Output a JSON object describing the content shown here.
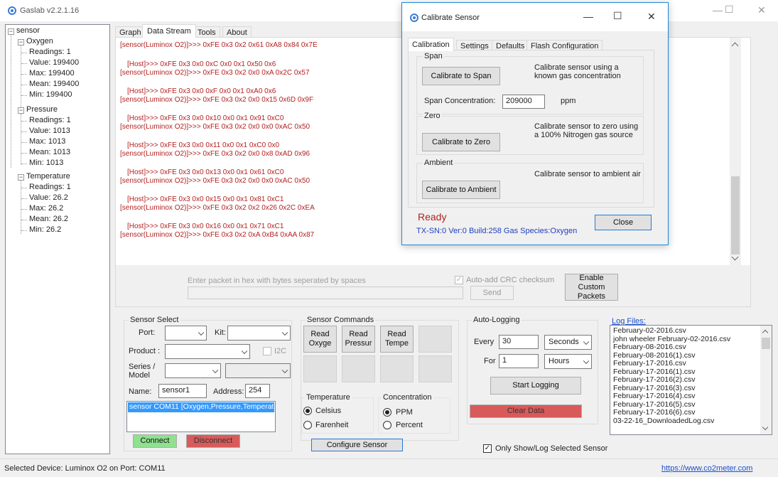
{
  "main_window": {
    "title": "Gaslab v2.2.1.16",
    "controls": {
      "minimize": "—",
      "maximize": "☐",
      "close": "✕"
    }
  },
  "tree": {
    "root": "sensor",
    "groups": [
      {
        "name": "Oxygen",
        "items": [
          "Readings: 1",
          "Value: 199400",
          "Max: 199400",
          "Mean: 199400",
          "Min: 199400"
        ]
      },
      {
        "name": "Pressure",
        "items": [
          "Readings: 1",
          "Value: 1013",
          "Max: 1013",
          "Mean: 1013",
          "Min: 1013"
        ]
      },
      {
        "name": "Temperature",
        "items": [
          "Readings: 1",
          "Value: 26.2",
          "Max: 26.2",
          "Mean: 26.2",
          "Min: 26.2"
        ]
      }
    ]
  },
  "main_tabs": [
    "Graph",
    "Data Stream",
    "Tools",
    "About"
  ],
  "stream": [
    "[sensor(Luminox O2)]>>> 0xFE 0x3 0x2 0x61 0xA8 0x84 0x7E",
    "[Host]>>> 0xFE 0x3 0x0 0xC 0x0 0x1 0x50 0x6",
    "[sensor(Luminox O2)]>>> 0xFE 0x3 0x2 0x0 0xA 0x2C 0x57",
    "[Host]>>> 0xFE 0x3 0x0 0xF 0x0 0x1 0xA0 0x6",
    "[sensor(Luminox O2)]>>> 0xFE 0x3 0x2 0x0 0x15 0x6D 0x9F",
    "[Host]>>> 0xFE 0x3 0x0 0x10 0x0 0x1 0x91 0xC0",
    "[sensor(Luminox O2)]>>> 0xFE 0x3 0x2 0x0 0x0 0xAC 0x50",
    "[Host]>>> 0xFE 0x3 0x0 0x11 0x0 0x1 0xC0 0x0",
    "[sensor(Luminox O2)]>>> 0xFE 0x3 0x2 0x0 0x8 0xAD 0x96",
    "[Host]>>> 0xFE 0x3 0x0 0x13 0x0 0x1 0x61 0xC0",
    "[sensor(Luminox O2)]>>> 0xFE 0x3 0x2 0x0 0x0 0xAC 0x50",
    "[Host]>>> 0xFE 0x3 0x0 0x15 0x0 0x1 0x81 0xC1",
    "[sensor(Luminox O2)]>>> 0xFE 0x3 0x2 0x2 0x26 0x2C 0xEA",
    "[Host]>>> 0xFE 0x3 0x0 0x16 0x0 0x1 0x71 0xC1",
    "[sensor(Luminox O2)]>>> 0xFE 0x3 0x2 0xA 0xB4 0xAA 0x87"
  ],
  "packet": {
    "placeholder": "Enter packet in hex with bytes seperated by spaces",
    "crc_label": "Auto-add CRC checksum",
    "send": "Send",
    "enable_custom": "Enable Custom Packets"
  },
  "sensor_select": {
    "title": "Sensor Select",
    "port_label": "Port:",
    "kit_label": "Kit:",
    "product_label": "Product :",
    "i2c_label": "I2C",
    "series_label": "Series / Model",
    "name_label": "Name:",
    "name_value": "sensor1",
    "address_label": "Address:",
    "address_value": "254",
    "list_item": "sensor COM11 [Oxygen,Pressure,Temperat",
    "connect": "Connect",
    "disconnect": "Disconnect"
  },
  "sensor_commands": {
    "title": "Sensor Commands",
    "buttons": [
      "Read Oxyge",
      "Read Pressur",
      "Read Tempe"
    ],
    "temperature_title": "Temperature",
    "celsius": "Celsius",
    "farenheit": "Farenheit",
    "concentration_title": "Concentration",
    "ppm": "PPM",
    "percent": "Percent",
    "configure": "Configure Sensor"
  },
  "auto_logging": {
    "title": "Auto-Logging",
    "every_label": "Every",
    "every_value": "30",
    "every_unit": "Seconds",
    "for_label": "For",
    "for_value": "1",
    "for_unit": "Hours",
    "start": "Start Logging",
    "clear": "Clear Data",
    "only_show": "Only Show/Log Selected Sensor"
  },
  "log_files": {
    "title": "Log Files:",
    "files": [
      "February-02-2016.csv",
      "john wheeler February-02-2016.csv",
      "February-08-2016.csv",
      "February-08-2016(1).csv",
      "February-17-2016.csv",
      "February-17-2016(1).csv",
      "February-17-2016(2).csv",
      "February-17-2016(3).csv",
      "February-17-2016(4).csv",
      "February-17-2016(5).csv",
      "February-17-2016(6).csv",
      "03-22-16_DownloadedLog.csv"
    ]
  },
  "status_bar": {
    "text": "Selected Device: Luminox O2 on Port: COM11",
    "link": "https://www.co2meter.com"
  },
  "dialog": {
    "title": "Calibrate Sensor",
    "tabs": [
      "Calibration",
      "Settings",
      "Defaults",
      "Flash Configuration"
    ],
    "span_title": "Span",
    "span_button": "Calibrate to Span",
    "span_desc": "Calibrate sensor using a known gas concentration",
    "span_conc_label": "Span Concentration:",
    "span_conc_value": "209000",
    "span_unit": "ppm",
    "zero_title": "Zero",
    "zero_button": "Calibrate to Zero",
    "zero_desc": "Calibrate sensor to zero using a 100% Nitrogen gas source",
    "ambient_title": "Ambient",
    "ambient_button": "Calibrate to Ambient",
    "ambient_desc": "Calibrate sensor to ambient air",
    "status": "Ready",
    "info": "TX-SN:0  Ver:0 Build:258  Gas Species:Oxygen",
    "close": "Close"
  },
  "colors": {
    "stream_text": "#b42020",
    "connect_bg": "#8fe08f",
    "disconnect_bg": "#d95a5a",
    "clear_bg": "#d95a5a",
    "ready_text": "#b42020",
    "info_text": "#2040c0",
    "selection": "#3399ff",
    "link": "#1a4fd0"
  }
}
